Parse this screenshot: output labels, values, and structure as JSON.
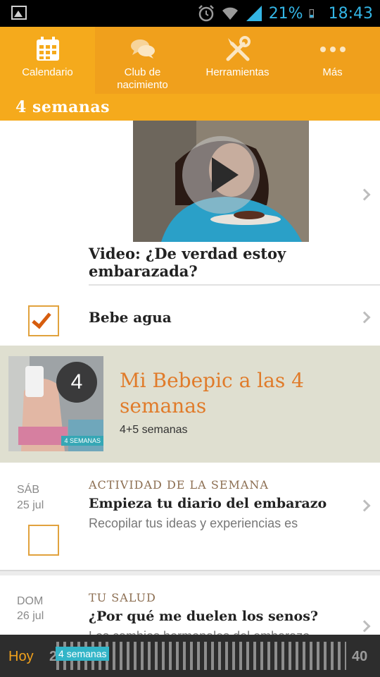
{
  "status_bar": {
    "battery": "21%",
    "time": "18:43"
  },
  "tabs": [
    {
      "label": "Calendario",
      "icon": "calendar-icon",
      "active": true
    },
    {
      "label": "Club de nacimiento",
      "icon": "chat-bubbles-icon",
      "active": false
    },
    {
      "label": "Herramientas",
      "icon": "tools-icon",
      "active": false
    },
    {
      "label": "Más",
      "icon": "more-dots-icon",
      "active": false
    }
  ],
  "week_header": "4 semanas",
  "video": {
    "title": "Video: ¿De verdad estoy embarazada?"
  },
  "task": {
    "label": "Bebe agua",
    "checked": true
  },
  "bebepic": {
    "badge": "4",
    "tag": "4 SEMANAS",
    "title": "Mi Bebepic a las 4 semanas",
    "subtitle": "4+5 semanas"
  },
  "cards": [
    {
      "day": "SÁB",
      "date": "25 jul",
      "category": "ACTIVIDAD DE LA SEMANA",
      "title": "Empieza tu diario del embarazo",
      "description": "Recopilar tus ideas y experiencias es",
      "checked": false
    },
    {
      "day": "DOM",
      "date": "26 jul",
      "category": "TU SALUD",
      "title": "¿Por qué me duelen los senos?",
      "description": "Los cambios hormonales del embarazo"
    }
  ],
  "timeline": {
    "today_label": "Hoy",
    "start": "2",
    "end": "40",
    "current_label": "4 semanas"
  },
  "colors": {
    "accent": "#f0a01c",
    "tab_active": "#f5aa1c",
    "bebepic_bg": "#dfdfd0",
    "title_orange": "#e07b2a",
    "status_blue": "#33b5e5"
  }
}
